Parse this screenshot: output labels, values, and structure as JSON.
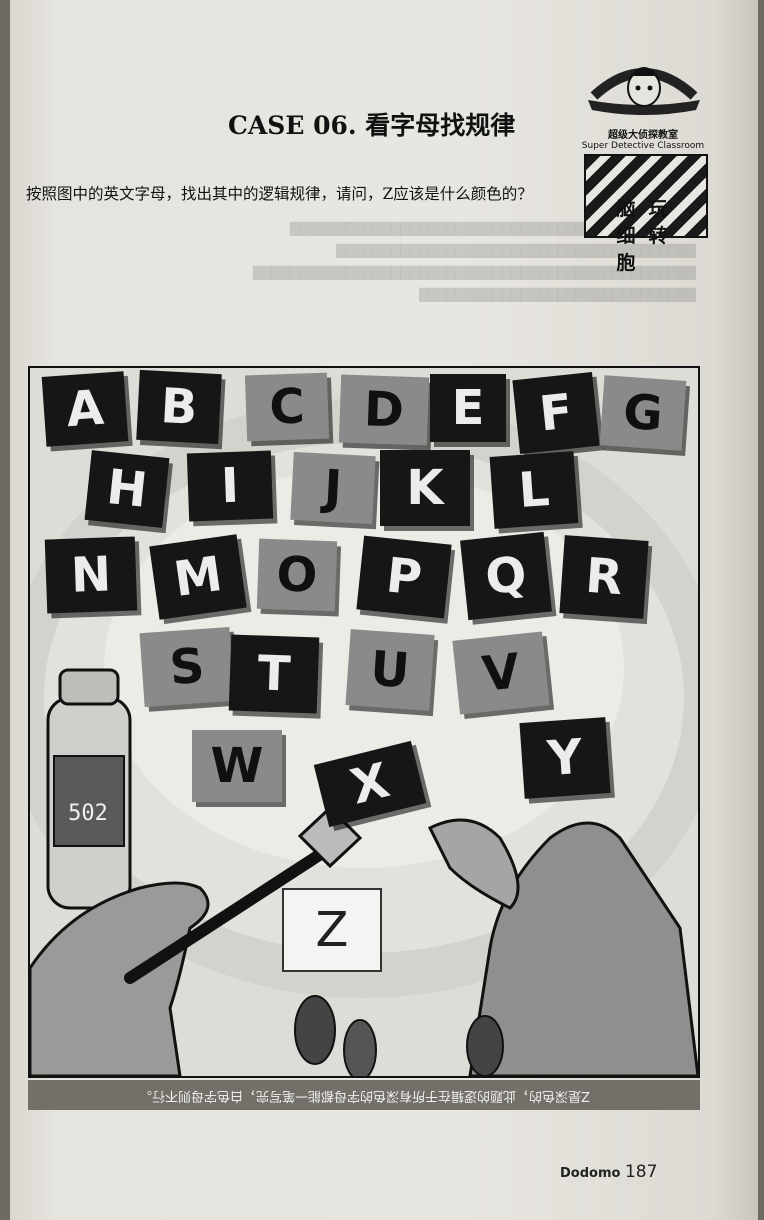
{
  "case_title": "CASE 06. 看字母找规律",
  "question": "按照图中的英文字母，找出其中的逻辑规律，请问，Z应该是什么颜色的？",
  "badge": {
    "cn": "超级大侦探教室",
    "en": "Super Detective Classroom",
    "col1": [
      "脑",
      "细",
      "胞"
    ],
    "col2": [
      "玩",
      "转"
    ]
  },
  "letters": [
    {
      "ch": "A",
      "shade": "dark"
    },
    {
      "ch": "B",
      "shade": "dark"
    },
    {
      "ch": "C",
      "shade": "gray"
    },
    {
      "ch": "D",
      "shade": "gray"
    },
    {
      "ch": "E",
      "shade": "dark"
    },
    {
      "ch": "F",
      "shade": "dark"
    },
    {
      "ch": "G",
      "shade": "gray"
    },
    {
      "ch": "H",
      "shade": "dark"
    },
    {
      "ch": "I",
      "shade": "dark"
    },
    {
      "ch": "J",
      "shade": "gray"
    },
    {
      "ch": "K",
      "shade": "dark"
    },
    {
      "ch": "L",
      "shade": "dark"
    },
    {
      "ch": "N",
      "shade": "dark"
    },
    {
      "ch": "M",
      "shade": "dark"
    },
    {
      "ch": "O",
      "shade": "gray"
    },
    {
      "ch": "P",
      "shade": "dark"
    },
    {
      "ch": "Q",
      "shade": "dark"
    },
    {
      "ch": "R",
      "shade": "dark"
    },
    {
      "ch": "S",
      "shade": "gray"
    },
    {
      "ch": "T",
      "shade": "dark"
    },
    {
      "ch": "U",
      "shade": "gray"
    },
    {
      "ch": "V",
      "shade": "gray"
    },
    {
      "ch": "W",
      "shade": "gray"
    },
    {
      "ch": "X",
      "shade": "dark"
    },
    {
      "ch": "Y",
      "shade": "dark"
    },
    {
      "ch": "Z",
      "shade": "white"
    }
  ],
  "glue_label": "502",
  "answer_upside_down": "Z是深色的，此题的逻辑在于所有深色的字母都能一笔写完，白色字母则不行。",
  "footer": {
    "brand": "Dodomo",
    "page": "187"
  }
}
